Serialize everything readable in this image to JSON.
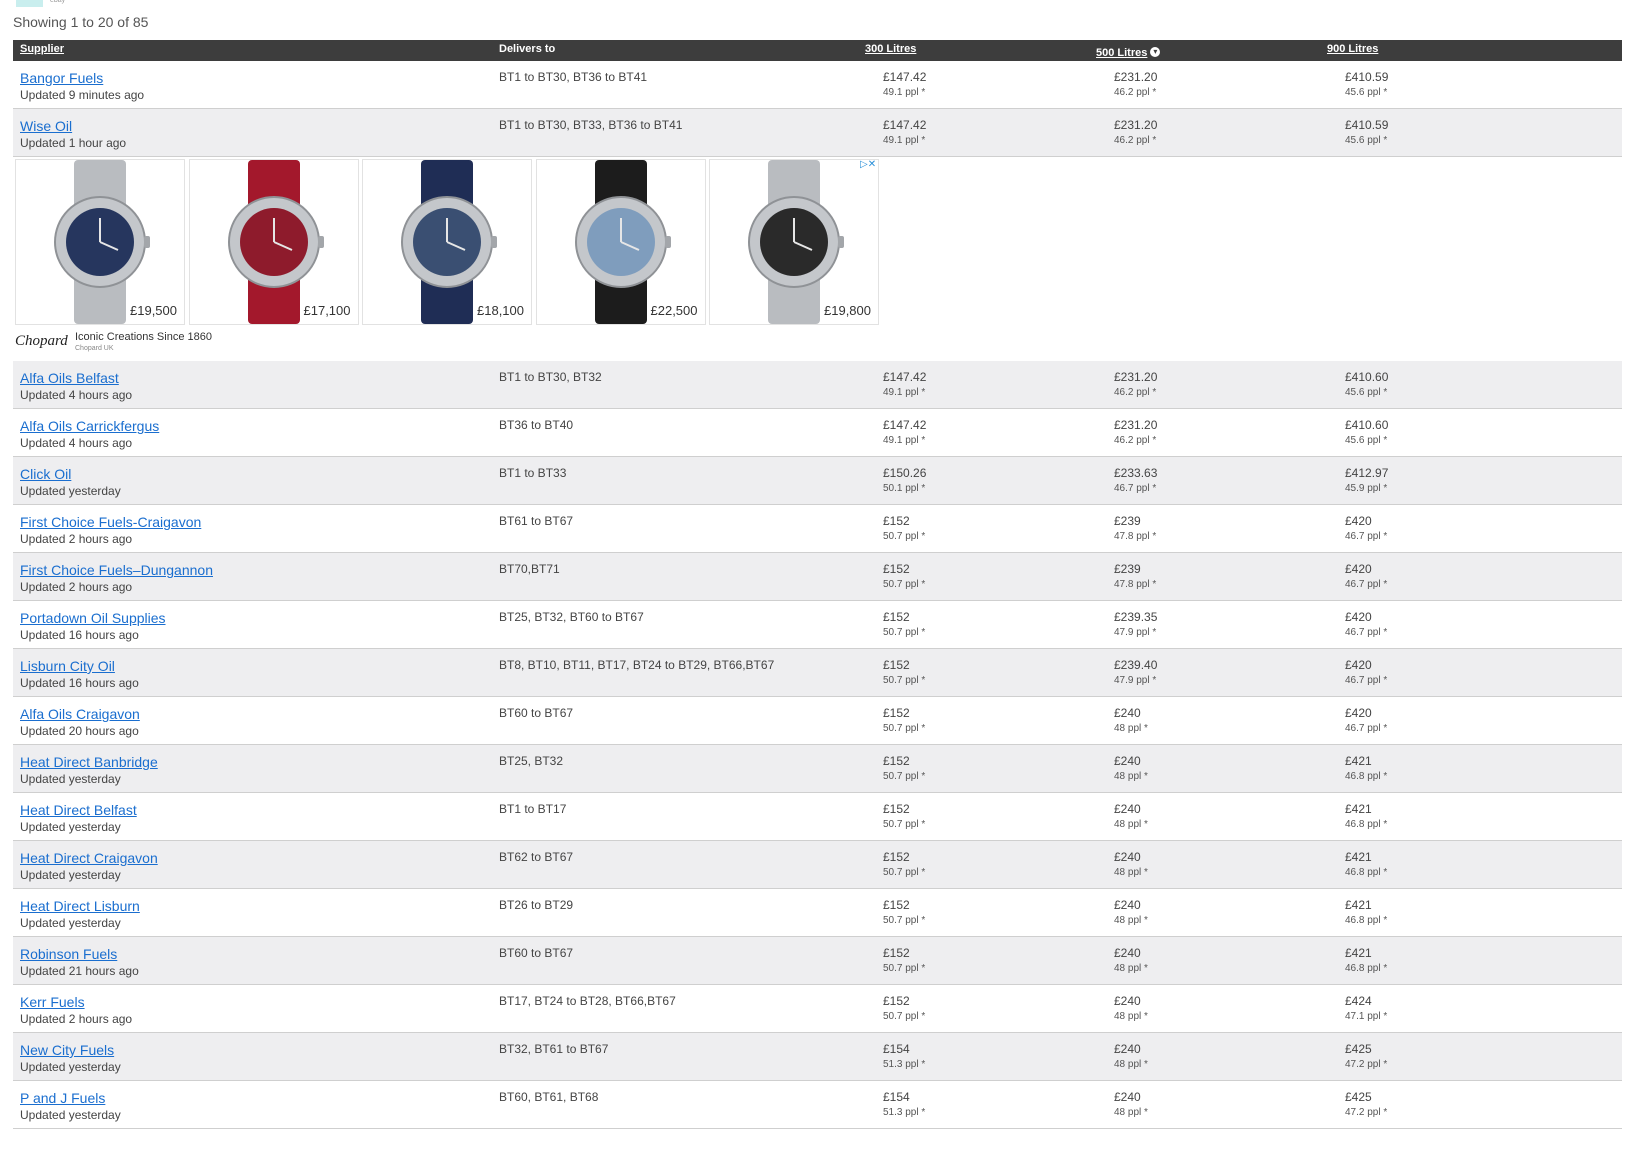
{
  "top_label": "ebay",
  "showing": "Showing 1 to 20 of 85",
  "header": {
    "supplier": "Supplier",
    "delivers": "Delivers to",
    "l300": "300 Litres",
    "l500": "500 Litres",
    "l900": "900 Litres"
  },
  "rows": [
    {
      "name": "Bangor Fuels",
      "updated": "Updated 9 minutes ago",
      "areas": "BT1 to BT30, BT36 to BT41",
      "p300": "£147.42",
      "ppl300": "49.1 ppl *",
      "p500": "£231.20",
      "ppl500": "46.2 ppl *",
      "p900": "£410.59",
      "ppl900": "45.6 ppl *"
    },
    {
      "name": "Wise Oil",
      "updated": "Updated 1 hour ago",
      "areas": "BT1 to BT30, BT33, BT36 to BT41",
      "p300": "£147.42",
      "ppl300": "49.1 ppl *",
      "p500": "£231.20",
      "ppl500": "46.2 ppl *",
      "p900": "£410.59",
      "ppl900": "45.6 ppl *"
    },
    {
      "name": "Alfa Oils Belfast",
      "updated": "Updated 4 hours ago",
      "areas": "BT1 to BT30, BT32",
      "p300": "£147.42",
      "ppl300": "49.1 ppl *",
      "p500": "£231.20",
      "ppl500": "46.2 ppl *",
      "p900": "£410.60",
      "ppl900": "45.6 ppl *"
    },
    {
      "name": "Alfa Oils Carrickfergus",
      "updated": "Updated 4 hours ago",
      "areas": "BT36 to BT40",
      "p300": "£147.42",
      "ppl300": "49.1 ppl *",
      "p500": "£231.20",
      "ppl500": "46.2 ppl *",
      "p900": "£410.60",
      "ppl900": "45.6 ppl *"
    },
    {
      "name": "Click Oil",
      "updated": "Updated yesterday",
      "areas": "BT1 to BT33",
      "p300": "£150.26",
      "ppl300": "50.1 ppl *",
      "p500": "£233.63",
      "ppl500": "46.7 ppl *",
      "p900": "£412.97",
      "ppl900": "45.9 ppl *"
    },
    {
      "name": "First Choice Fuels-Craigavon",
      "updated": "Updated 2 hours ago",
      "areas": "BT61 to BT67",
      "p300": "£152",
      "ppl300": "50.7 ppl *",
      "p500": "£239",
      "ppl500": "47.8 ppl *",
      "p900": "£420",
      "ppl900": "46.7 ppl *"
    },
    {
      "name": "First Choice Fuels–Dungannon",
      "updated": "Updated 2 hours ago",
      "areas": "BT70,BT71",
      "p300": "£152",
      "ppl300": "50.7 ppl *",
      "p500": "£239",
      "ppl500": "47.8 ppl *",
      "p900": "£420",
      "ppl900": "46.7 ppl *"
    },
    {
      "name": "Portadown Oil Supplies",
      "updated": "Updated 16 hours ago",
      "areas": "BT25, BT32, BT60 to BT67",
      "p300": "£152",
      "ppl300": "50.7 ppl *",
      "p500": "£239.35",
      "ppl500": "47.9 ppl *",
      "p900": "£420",
      "ppl900": "46.7 ppl *"
    },
    {
      "name": "Lisburn City Oil",
      "updated": "Updated 16 hours ago",
      "areas": "BT8, BT10, BT11, BT17, BT24 to BT29, BT66,BT67",
      "p300": "£152",
      "ppl300": "50.7 ppl *",
      "p500": "£239.40",
      "ppl500": "47.9 ppl *",
      "p900": "£420",
      "ppl900": "46.7 ppl *"
    },
    {
      "name": "Alfa Oils Craigavon",
      "updated": "Updated 20 hours ago",
      "areas": "BT60 to BT67",
      "p300": "£152",
      "ppl300": "50.7 ppl *",
      "p500": "£240",
      "ppl500": "48 ppl *",
      "p900": "£420",
      "ppl900": "46.7 ppl *"
    },
    {
      "name": "Heat Direct Banbridge",
      "updated": "Updated yesterday",
      "areas": "BT25, BT32",
      "p300": "£152",
      "ppl300": "50.7 ppl *",
      "p500": "£240",
      "ppl500": "48 ppl *",
      "p900": "£421",
      "ppl900": "46.8 ppl *"
    },
    {
      "name": "Heat Direct Belfast",
      "updated": "Updated yesterday",
      "areas": "BT1 to BT17",
      "p300": "£152",
      "ppl300": "50.7 ppl *",
      "p500": "£240",
      "ppl500": "48 ppl *",
      "p900": "£421",
      "ppl900": "46.8 ppl *"
    },
    {
      "name": "Heat Direct Craigavon",
      "updated": "Updated yesterday",
      "areas": "BT62 to BT67",
      "p300": "£152",
      "ppl300": "50.7 ppl *",
      "p500": "£240",
      "ppl500": "48 ppl *",
      "p900": "£421",
      "ppl900": "46.8 ppl *"
    },
    {
      "name": "Heat Direct Lisburn",
      "updated": "Updated yesterday",
      "areas": "BT26 to BT29",
      "p300": "£152",
      "ppl300": "50.7 ppl *",
      "p500": "£240",
      "ppl500": "48 ppl *",
      "p900": "£421",
      "ppl900": "46.8 ppl *"
    },
    {
      "name": "Robinson Fuels",
      "updated": "Updated 21 hours ago",
      "areas": "BT60 to BT67",
      "p300": "£152",
      "ppl300": "50.7 ppl *",
      "p500": "£240",
      "ppl500": "48 ppl *",
      "p900": "£421",
      "ppl900": "46.8 ppl *"
    },
    {
      "name": "Kerr Fuels",
      "updated": "Updated 2 hours ago",
      "areas": "BT17, BT24 to BT28, BT66,BT67",
      "p300": "£152",
      "ppl300": "50.7 ppl *",
      "p500": "£240",
      "ppl500": "48 ppl *",
      "p900": "£424",
      "ppl900": "47.1 ppl *"
    },
    {
      "name": "New City Fuels",
      "updated": "Updated yesterday",
      "areas": "BT32, BT61 to BT67",
      "p300": "£154",
      "ppl300": "51.3 ppl *",
      "p500": "£240",
      "ppl500": "48 ppl *",
      "p900": "£425",
      "ppl900": "47.2 ppl *"
    },
    {
      "name": "P and J Fuels",
      "updated": "Updated yesterday",
      "areas": "BT60, BT61, BT68",
      "p300": "£154",
      "ppl300": "51.3 ppl *",
      "p500": "£240",
      "ppl500": "48 ppl *",
      "p900": "£425",
      "ppl900": "47.2 ppl *"
    }
  ],
  "ad": {
    "items": [
      {
        "price": "£19,500",
        "dial": "#26365e",
        "strap": "#b9bcc0"
      },
      {
        "price": "£17,100",
        "dial": "#8e1b2c",
        "strap": "#a3182c"
      },
      {
        "price": "£18,100",
        "dial": "#3a4f72",
        "strap": "#1f2d55"
      },
      {
        "price": "£22,500",
        "dial": "#7f9dbd",
        "strap": "#1c1c1c"
      },
      {
        "price": "£19,800",
        "dial": "#2a2a2a",
        "strap": "#b9bcc0"
      }
    ],
    "logo": "Chopard",
    "tagline": "Iconic Creations Since 1860",
    "brand": "Chopard UK",
    "choices_icon": "adchoices-icon",
    "close_icon": "close-icon"
  }
}
